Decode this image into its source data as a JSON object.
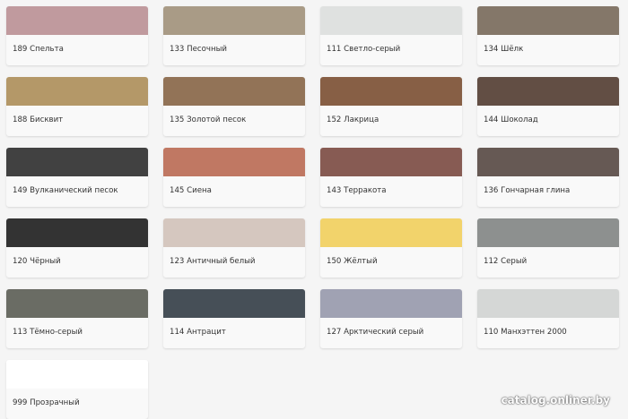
{
  "colors": [
    {
      "label": "189 Спельта",
      "color": "#c09a9e"
    },
    {
      "label": "133 Песочный",
      "color": "#a99b86"
    },
    {
      "label": "111 Светло-серый",
      "color": "#dfe1e0"
    },
    {
      "label": "134 Шёлк",
      "color": "#847769"
    },
    {
      "label": "188 Бисквит",
      "color": "#b49868"
    },
    {
      "label": "135 Золотой песок",
      "color": "#927357"
    },
    {
      "label": "152 Лакрица",
      "color": "#875f45"
    },
    {
      "label": "144 Шоколад",
      "color": "#624e44"
    },
    {
      "label": "149 Вулканический песок",
      "color": "#414141"
    },
    {
      "label": "145 Сиена",
      "color": "#c07863"
    },
    {
      "label": "143 Терракота",
      "color": "#875b53"
    },
    {
      "label": "136 Гончарная глина",
      "color": "#665954"
    },
    {
      "label": "120 Чёрный",
      "color": "#333333"
    },
    {
      "label": "123 Античный белый",
      "color": "#d5c7bf"
    },
    {
      "label": "150 Жёлтый",
      "color": "#f2d36b"
    },
    {
      "label": "112 Серый",
      "color": "#8d908f"
    },
    {
      "label": "113 Тёмно-серый",
      "color": "#6a6c64"
    },
    {
      "label": "114 Антрацит",
      "color": "#464f57"
    },
    {
      "label": "127 Арктический серый",
      "color": "#a0a2b3"
    },
    {
      "label": "110 Манхэттен 2000",
      "color": "#d5d7d6"
    },
    {
      "label": "999 Прозрачный",
      "color": "#ffffff"
    }
  ],
  "watermark": "catalog.onliner.by"
}
